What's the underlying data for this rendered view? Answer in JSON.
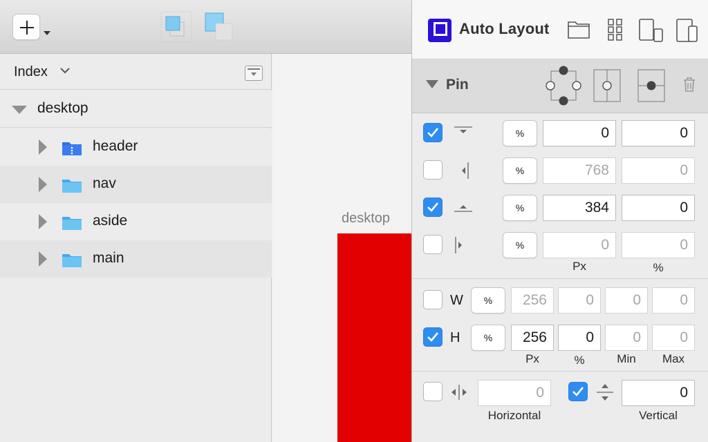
{
  "toolbar": {
    "add_icon": "plus-icon",
    "align_icon_1": "overlap-back-icon",
    "align_icon_2": "overlap-front-icon"
  },
  "sidebar": {
    "index_label": "Index",
    "layers": [
      {
        "name": "desktop",
        "type": "artboard",
        "expanded": true
      },
      {
        "name": "header",
        "type": "folder",
        "color": "#2f6fe6"
      },
      {
        "name": "nav",
        "type": "folder",
        "color": "#5fb8f0"
      },
      {
        "name": "aside",
        "type": "folder",
        "color": "#5fb8f0"
      },
      {
        "name": "main",
        "type": "folder",
        "color": "#5fb8f0"
      }
    ]
  },
  "canvas": {
    "artboard_title": "desktop",
    "artboard_color": "#e30000"
  },
  "panel": {
    "title": "Auto Layout",
    "toolbar_icons": [
      "folder-icon",
      "grid-icon",
      "tablet-phone-icon",
      "phone-tablet-icon"
    ],
    "pin": {
      "label": "Pin",
      "rows": [
        {
          "side": "top",
          "checked": true,
          "pct_label": "%",
          "px": "0",
          "percent": "0",
          "px_dim": false,
          "pct_dim": false
        },
        {
          "side": "right",
          "checked": false,
          "pct_label": "%",
          "px": "768",
          "percent": "0",
          "px_dim": true,
          "pct_dim": true
        },
        {
          "side": "bottom",
          "checked": true,
          "pct_label": "%",
          "px": "384",
          "percent": "0",
          "px_dim": false,
          "pct_dim": false
        },
        {
          "side": "left",
          "checked": false,
          "pct_label": "%",
          "px": "0",
          "percent": "0",
          "px_dim": true,
          "pct_dim": true
        }
      ],
      "col_px": "Px",
      "col_pct": "%"
    },
    "size": {
      "rows": [
        {
          "label": "W",
          "checked": false,
          "pct_label": "%",
          "px": "256",
          "percent": "0",
          "min": "0",
          "max": "0"
        },
        {
          "label": "H",
          "checked": true,
          "pct_label": "%",
          "px": "256",
          "percent": "0",
          "min": "0",
          "max": "0"
        }
      ],
      "col_px": "Px",
      "col_pct": "%",
      "col_min": "Min",
      "col_max": "Max"
    },
    "center": {
      "horizontal": {
        "checked": false,
        "value": "0",
        "label": "Horizontal"
      },
      "vertical": {
        "checked": true,
        "value": "0",
        "label": "Vertical"
      }
    }
  }
}
